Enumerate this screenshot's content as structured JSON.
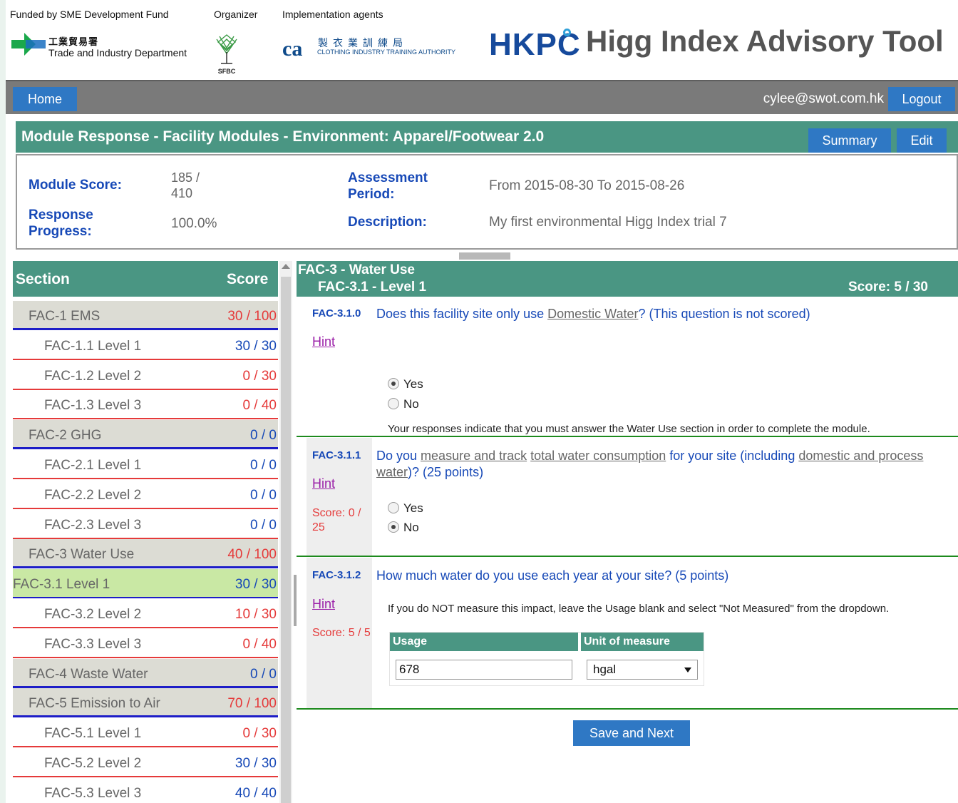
{
  "header": {
    "funded_by": "Funded by SME Development Fund",
    "organizer": "Organizer",
    "implementation": "Implementation agents",
    "tid_zh": "工業貿易署",
    "tid_en": "Trade and Industry Department",
    "sfbc": "SFBC",
    "cita_abbr": "ca",
    "cita_zh": "製衣業訓練局",
    "cita_en": "CLOTHING INDUSTRY TRAINING AUTHORITY",
    "hkpc": "HKPC",
    "app_title": "Higg Index Advisory Tool"
  },
  "nav": {
    "home": "Home",
    "user": "cylee@swot.com.hk",
    "logout": "Logout"
  },
  "module": {
    "title": "Module Response - Facility Modules - Environment: Apparel/Footwear 2.0",
    "summary": "Summary",
    "edit": "Edit",
    "score_label": "Module Score:",
    "score_value_1": "185 /",
    "score_value_2": "410",
    "progress_label_1": "Response",
    "progress_label_2": "Progress:",
    "progress_value": "100.0%",
    "period_label_1": "Assessment",
    "period_label_2": "Period:",
    "period_value": "From 2015-08-30 To 2015-08-26",
    "desc_label": "Description:",
    "desc_value": "My first environmental Higg Index trial 7"
  },
  "left": {
    "col_section": "Section",
    "col_score": "Score",
    "rows": [
      {
        "label": "FAC-1 EMS",
        "score": "30 / 100",
        "type": "sec",
        "color": "#e53a3a"
      },
      {
        "label": "FAC-1.1 Level 1",
        "score": "30 / 30",
        "type": "sub",
        "color": "#1749b7"
      },
      {
        "label": "FAC-1.2 Level 2",
        "score": "0 / 30",
        "type": "sub",
        "color": "#e53a3a"
      },
      {
        "label": "FAC-1.3 Level 3",
        "score": "0 / 40",
        "type": "sub",
        "color": "#e53a3a"
      },
      {
        "label": "FAC-2 GHG",
        "score": "0 / 0",
        "type": "sec",
        "color": "#1749b7"
      },
      {
        "label": "FAC-2.1 Level 1",
        "score": "0 / 0",
        "type": "sub",
        "color": "#1749b7"
      },
      {
        "label": "FAC-2.2 Level 2",
        "score": "0 / 0",
        "type": "sub",
        "color": "#1749b7"
      },
      {
        "label": "FAC-2.3 Level 3",
        "score": "0 / 0",
        "type": "sub",
        "color": "#1749b7"
      },
      {
        "label": "FAC-3 Water Use",
        "score": "40 / 100",
        "type": "sec",
        "color": "#e53a3a"
      },
      {
        "label": "FAC-3.1 Level 1",
        "score": "30 / 30",
        "type": "active",
        "color": "#1749b7"
      },
      {
        "label": "FAC-3.2 Level 2",
        "score": "10 / 30",
        "type": "sub",
        "color": "#e53a3a"
      },
      {
        "label": "FAC-3.3 Level 3",
        "score": "0 / 40",
        "type": "sub",
        "color": "#e53a3a"
      },
      {
        "label": "FAC-4 Waste Water",
        "score": "0 / 0",
        "type": "sec",
        "color": "#1749b7"
      },
      {
        "label": "FAC-5 Emission to Air",
        "score": "70 / 100",
        "type": "sec",
        "color": "#e53a3a"
      },
      {
        "label": "FAC-5.1 Level 1",
        "score": "0 / 30",
        "type": "sub",
        "color": "#e53a3a"
      },
      {
        "label": "FAC-5.2 Level 2",
        "score": "30 / 30",
        "type": "sub",
        "color": "#1749b7"
      },
      {
        "label": "FAC-5.3 Level 3",
        "score": "40 / 40",
        "type": "sub",
        "color": "#1749b7"
      }
    ]
  },
  "right": {
    "title": "FAC-3 - Water Use",
    "subtitle": "FAC-3.1 - Level 1",
    "score": "Score: 5 / 30",
    "hint": "Hint",
    "q0": {
      "num": "FAC-3.1.0",
      "text_a": "Does this facility site only use ",
      "text_u1": "Domestic Water",
      "text_b": "? (This question is not scored)",
      "yes": "Yes",
      "no": "No",
      "selected": "Yes",
      "note": "Your responses indicate that you must answer the Water Use section in order to complete the module."
    },
    "q1": {
      "num": "FAC-3.1.1",
      "text_a": "Do you ",
      "text_u1": "measure and track",
      "text_b": " ",
      "text_u2": "total water consumption",
      "text_c": " for your site (including ",
      "text_u3": "domestic and process water",
      "text_d": ")?  (25 points)",
      "score": "Score: 0 / 25",
      "yes": "Yes",
      "no": "No",
      "selected": "No"
    },
    "q2": {
      "num": "FAC-3.1.2",
      "text": "How much water do you use each year at your site? (5 points)",
      "score": "Score: 5 / 5",
      "note": "If you do NOT measure this impact, leave the Usage blank and select \"Not Measured\" from the dropdown.",
      "col_usage": "Usage",
      "col_unit": "Unit of measure",
      "usage_value": "678",
      "unit_value": "hgal"
    },
    "save_next": "Save and Next"
  }
}
